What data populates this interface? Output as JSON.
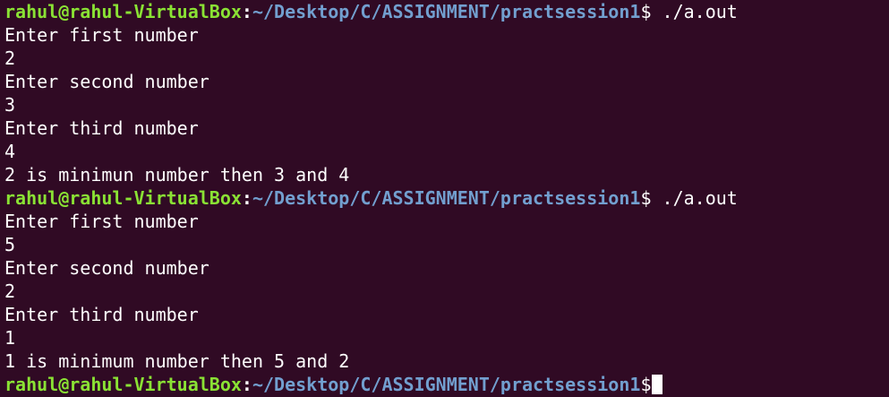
{
  "prompt": {
    "user_host": "rahul@rahul-VirtualBox",
    "colon": ":",
    "path": "~/Desktop/C/ASSIGNMENT/practsession1",
    "symbol": "$"
  },
  "lines": [
    {
      "kind": "prompt",
      "command": " ./a.out"
    },
    {
      "kind": "output",
      "text": "Enter first number"
    },
    {
      "kind": "output",
      "text": "2"
    },
    {
      "kind": "output",
      "text": "Enter second number"
    },
    {
      "kind": "output",
      "text": "3"
    },
    {
      "kind": "output",
      "text": "Enter third number"
    },
    {
      "kind": "output",
      "text": "4"
    },
    {
      "kind": "output",
      "text": "2 is minimun number then 3 and 4"
    },
    {
      "kind": "prompt",
      "command": " ./a.out"
    },
    {
      "kind": "output",
      "text": "Enter first number"
    },
    {
      "kind": "output",
      "text": "5"
    },
    {
      "kind": "output",
      "text": "Enter second number"
    },
    {
      "kind": "output",
      "text": "2"
    },
    {
      "kind": "output",
      "text": "Enter third number"
    },
    {
      "kind": "output",
      "text": "1"
    },
    {
      "kind": "output",
      "text": "1 is minimum number then 5 and 2"
    },
    {
      "kind": "prompt",
      "command": ""
    }
  ],
  "colors": {
    "background": "#300a24",
    "user_host": "#8ae234",
    "path": "#729fcf",
    "text": "#ffffff"
  }
}
